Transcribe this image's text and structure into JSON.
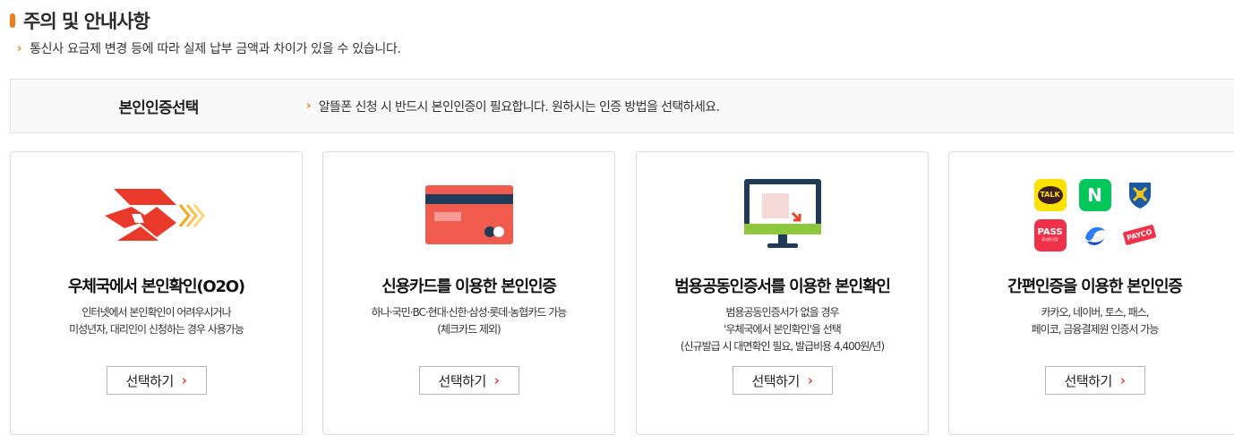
{
  "notice": {
    "title": "주의 및 안내사항",
    "line": "통신사 요금제 변경 등에 따라 실제 납부 금액과 차이가 있을 수 있습니다."
  },
  "auth": {
    "label": "본인인증선택",
    "description": "알뜰폰 신청 시 반드시 본인인증이 필요합니다. 원하시는 인증 방법을 선택하세요."
  },
  "cards": [
    {
      "title": "우체국에서 본인확인(O2O)",
      "desc": [
        "인터넷에서 본인확인이 어려우시거나",
        "미성년자, 대리인이 신청하는 경우 사용가능"
      ],
      "button": "선택하기",
      "icon": "post-office-logo-icon"
    },
    {
      "title": "신용카드를 이용한 본인인증",
      "desc": [
        "하나·국민·BC·현대·신한·삼성·롯데·농협카드 가능",
        "(체크카드 제외)"
      ],
      "button": "선택하기",
      "icon": "credit-card-icon"
    },
    {
      "title": "범용공동인증서를 이용한 본인확인",
      "desc": [
        "범용공동인증서가 없을 경우",
        "'우체국에서 본인확인'을 선택",
        "(신규발급 시 대면확인 필요, 발급비용 4,400원/년)"
      ],
      "button": "선택하기",
      "icon": "monitor-certificate-icon"
    },
    {
      "title": "간편인증을 이용한 본인인증",
      "desc": [
        "카카오, 네이버, 토스, 패스,",
        "페이코, 금융결제원 인증서 가능"
      ],
      "button": "선택하기",
      "icon": "easy-auth-icons",
      "easy_icons": {
        "kakao": "TALK",
        "naver": "N",
        "pass": "PASS",
        "pass_sub": "휴대폰인증",
        "payco": "PAYCO"
      }
    }
  ],
  "colors": {
    "accent": "#f07d1a",
    "chevron": "#e8432b",
    "post_red": "#e8392b",
    "card_red": "#f05b4e",
    "monitor_navy": "#1f3b57",
    "monitor_green": "#8dc63f"
  }
}
